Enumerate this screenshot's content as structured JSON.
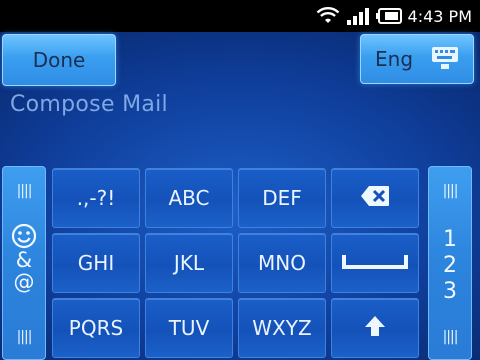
{
  "status": {
    "time": "4:43 PM"
  },
  "toolbar": {
    "done_label": "Done",
    "lang_label": "Eng"
  },
  "compose": {
    "title": "Compose Mail"
  },
  "left_strip": {
    "symbols_line1": "&",
    "symbols_line2": "@"
  },
  "right_strip": {
    "numbers": [
      "1",
      "2",
      "3"
    ]
  },
  "keys": [
    {
      "label": ".,-?!"
    },
    {
      "label": "ABC"
    },
    {
      "label": "DEF"
    },
    {
      "label": ""
    },
    {
      "label": "GHI"
    },
    {
      "label": "JKL"
    },
    {
      "label": "MNO"
    },
    {
      "label": ""
    },
    {
      "label": "PQRS"
    },
    {
      "label": "TUV"
    },
    {
      "label": "WXYZ"
    },
    {
      "label": ""
    }
  ],
  "icons": {
    "wifi": "wifi-icon",
    "signal": "signal-icon",
    "battery": "battery-icon",
    "keyboard": "keyboard-icon",
    "backspace": "backspace-icon",
    "space": "space-icon",
    "shift": "shift-icon",
    "smiley": "smiley-icon"
  }
}
